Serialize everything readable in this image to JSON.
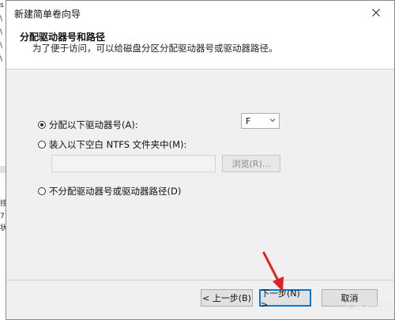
{
  "window": {
    "title": "新建简单卷向导"
  },
  "header": {
    "title": "分配驱动器号和路径",
    "subtitle": "为了便于访问，可以给磁盘分区分配驱动器号或驱动器路径。"
  },
  "options": {
    "assign_letter_label": "分配以下驱动器号(A):",
    "assign_letter_selected": true,
    "drive_letter_value": "F",
    "mount_folder_label": "装入以下空白 NTFS 文件夹中(M):",
    "mount_folder_selected": false,
    "folder_path_value": "",
    "browse_label": "浏览(R)...",
    "no_assign_label": "不分配驱动器号或驱动器路径(D)",
    "no_assign_selected": false
  },
  "footer": {
    "back_label": "< 上一步(B)",
    "next_label": "下一步(N) >",
    "cancel_label": "取消"
  },
  "background_window": {
    "fragments": [
      "s",
      "\\",
      "\\",
      "\\",
      "\\",
      "挂",
      "7",
      "状"
    ]
  },
  "annotation": {
    "arrow_color": "#e02020"
  },
  "watermark": {
    "text": "Bai经验"
  },
  "colors": {
    "dialog_bg": "#f0f0f0",
    "header_bg": "#ffffff",
    "focus_border": "#0078d7"
  }
}
